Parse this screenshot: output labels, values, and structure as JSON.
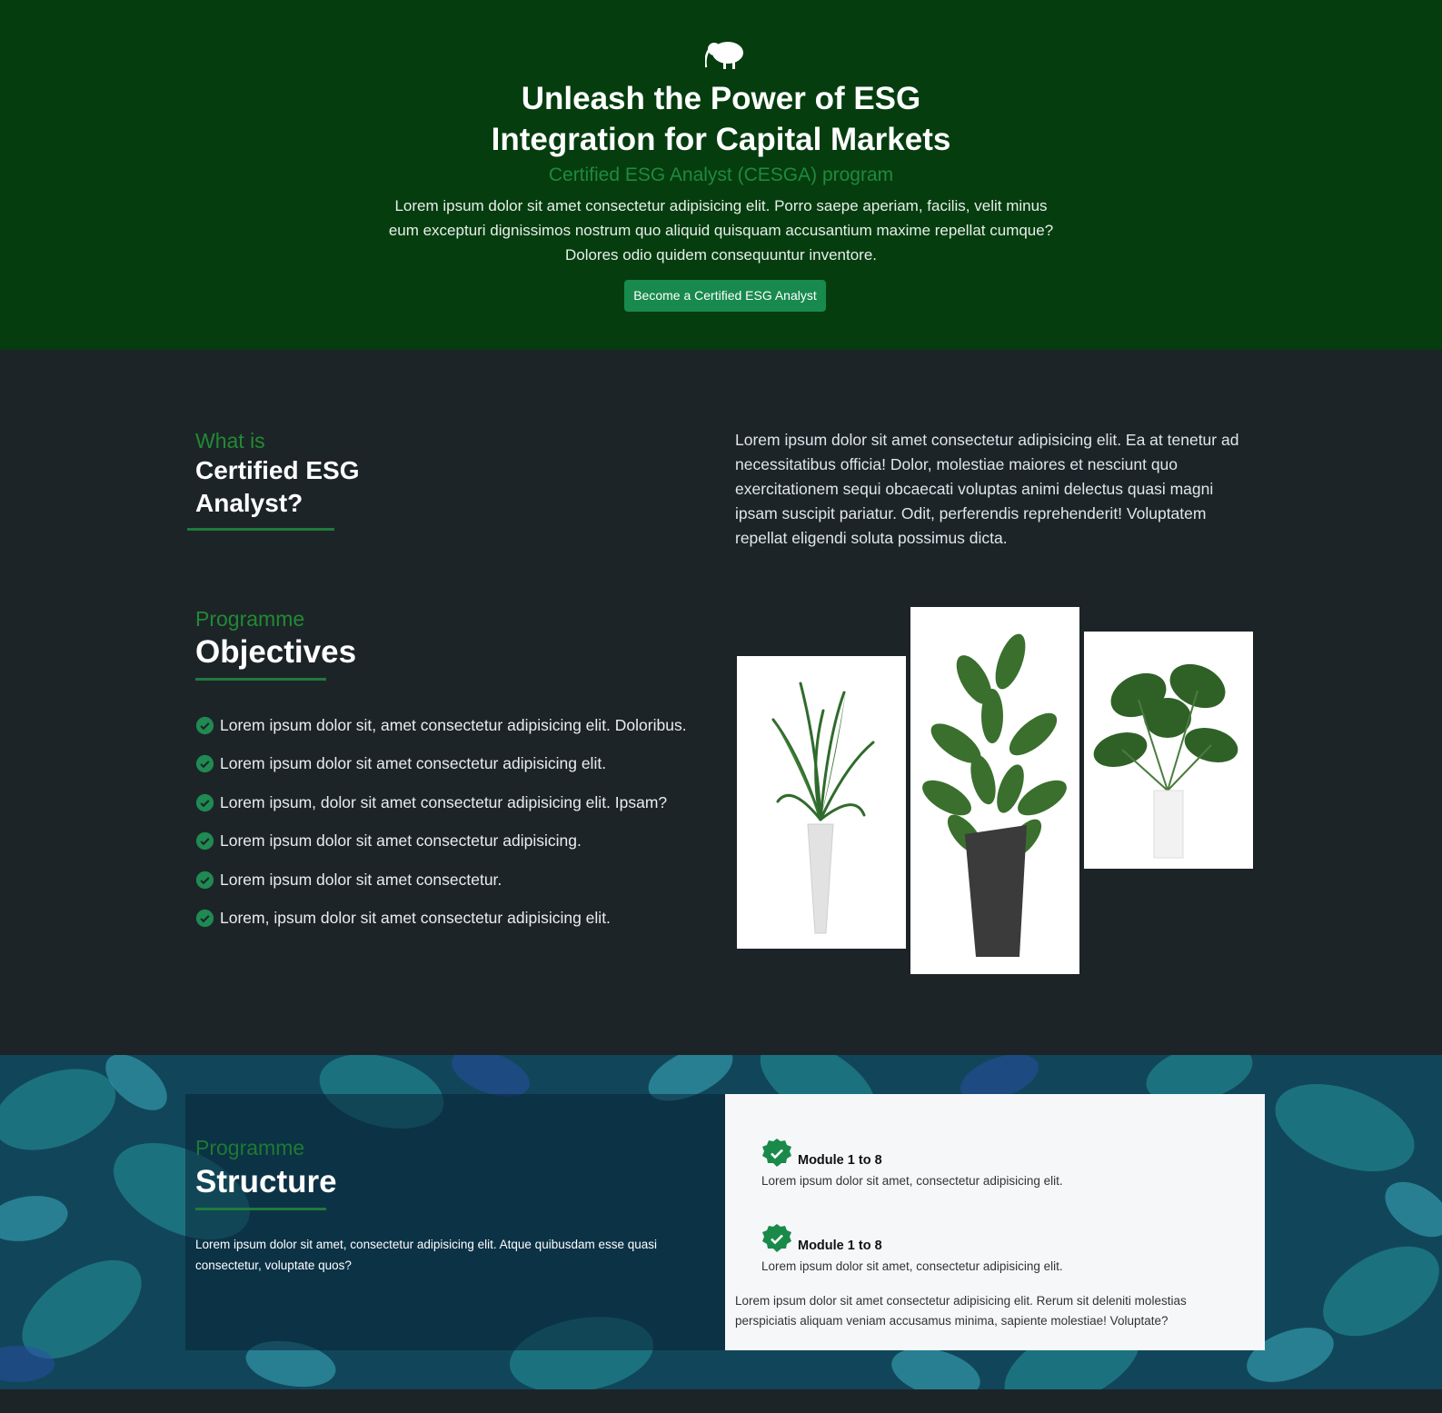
{
  "hero": {
    "logo_icon": "kiwi-bird-icon",
    "title_line1": "Unleash the Power of ESG",
    "title_line2": "Integration for Capital Markets",
    "subtitle": "Certified ESG Analyst (CESGA) program",
    "description": "Lorem ipsum dolor sit amet consectetur adipisicing elit. Porro saepe aperiam, facilis, velit minus eum excepturi dignissimos nostrum quo aliquid quisquam accusantium maxime repellat cumque? Dolores odio quidem consequuntur inventore.",
    "cta_label": "Become a Certified ESG Analyst"
  },
  "what_is": {
    "eyebrow": "What is",
    "title_line1": "Certified ESG",
    "title_line2": "Analyst?",
    "description": "Lorem ipsum dolor sit amet consectetur adipisicing elit. Ea at tenetur ad necessitatibus officia! Dolor, molestiae maiores et nesciunt quo exercitationem sequi obcaecati voluptas animi delectus quasi magni ipsam suscipit pariatur. Odit, perferendis reprehenderit! Voluptatem repellat eligendi soluta possimus dicta."
  },
  "objectives": {
    "eyebrow": "Programme",
    "title": "Objectives",
    "items": [
      "Lorem ipsum dolor sit, amet consectetur adipisicing elit. Doloribus.",
      "Lorem ipsum dolor sit amet consectetur adipisicing elit.",
      "Lorem ipsum, dolor sit amet consectetur adipisicing elit. Ipsam?",
      "Lorem ipsum dolor sit amet consectetur adipisicing.",
      "Lorem ipsum dolor sit amet consectetur.",
      "Lorem, ipsum dolor sit amet consectetur adipisicing elit."
    ]
  },
  "structure": {
    "eyebrow": "Programme",
    "title": "Structure",
    "description": "Lorem ipsum dolor sit amet, consectetur adipisicing elit. Atque quibusdam esse quasi consectetur, voluptate quos?",
    "modules": [
      {
        "title": "Module 1 to 8",
        "description": "Lorem ipsum dolor sit amet, consectetur adipisicing elit."
      },
      {
        "title": "Module 1 to 8",
        "description": "Lorem ipsum dolor sit amet, consectetur adipisicing elit."
      }
    ],
    "note": "Lorem ipsum dolor sit amet consectetur adipisicing elit. Rerum sit deleniti molestias perspiciatis aliquam veniam accusamus minima, sapiente molestiae! Voluptate?"
  },
  "colors": {
    "hero_bg": "#053d0f",
    "accent_green": "#218a32",
    "button_green": "#188a4d",
    "dark_bg": "#1d2428"
  }
}
